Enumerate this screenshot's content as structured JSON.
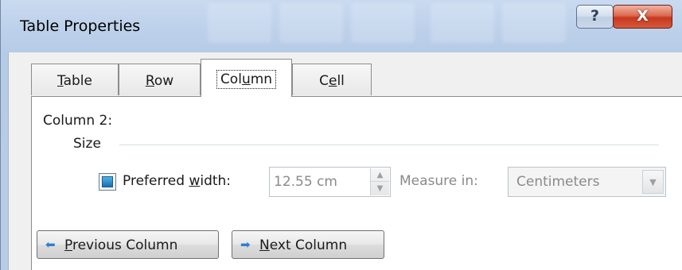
{
  "window": {
    "title": "Table Properties",
    "help_glyph": "?",
    "close_glyph": "X"
  },
  "tabs": [
    {
      "label_pre": "",
      "mnemonic": "T",
      "label_post": "able",
      "active": false
    },
    {
      "label_pre": "",
      "mnemonic": "R",
      "label_post": "ow",
      "active": false
    },
    {
      "label_pre": "Col",
      "mnemonic": "u",
      "label_post": "mn",
      "active": true
    },
    {
      "label_pre": "C",
      "mnemonic": "e",
      "label_post": "ll",
      "active": false
    }
  ],
  "panel": {
    "column_heading": "Column 2:",
    "size_group_label": "Size",
    "preferred_width": {
      "checked": true,
      "label_pre": "Preferred ",
      "mnemonic": "w",
      "label_post": "idth:",
      "value": "12.55 cm"
    },
    "measure_in": {
      "label": "Measure in:",
      "value": "Centimeters"
    },
    "buttons": {
      "previous": {
        "mnemonic": "P",
        "label_post": "revious Column",
        "icon": "arrow-left-icon"
      },
      "next": {
        "mnemonic": "N",
        "label_post": "ext Column",
        "icon": "arrow-right-icon"
      }
    }
  },
  "colors": {
    "title_bar": "#c9daf0",
    "close_button": "#c7371d",
    "checkbox_fill": "#1c6fb0",
    "arrow_icon": "#2c7fd0"
  }
}
